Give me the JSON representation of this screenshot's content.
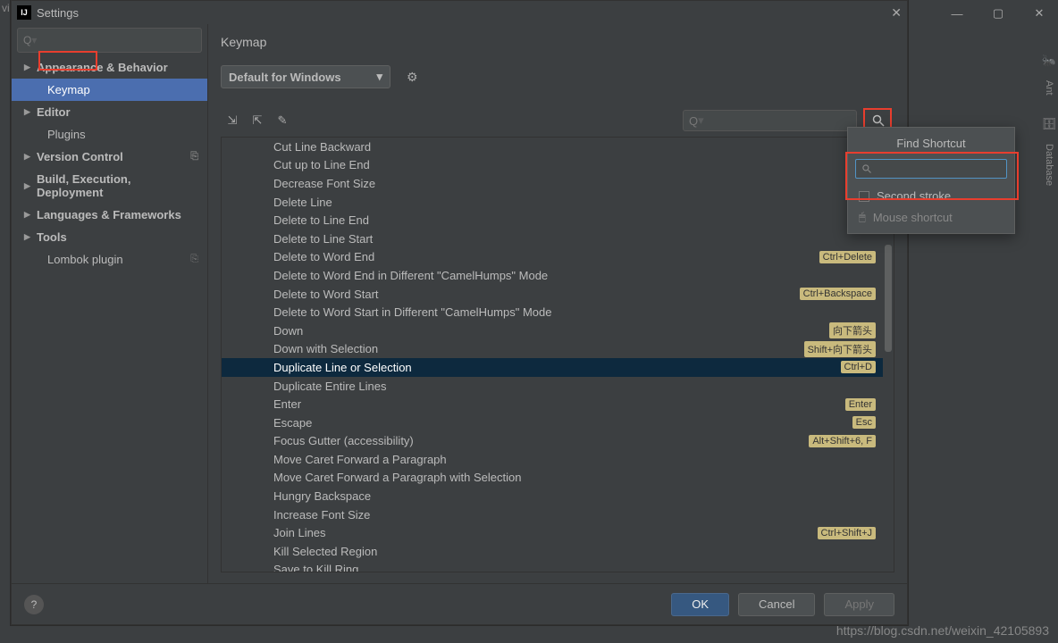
{
  "window": {
    "title": "Settings"
  },
  "tool_sidebar": {
    "ant_label": "Ant",
    "db_label": "Database"
  },
  "sidebar": {
    "items": [
      {
        "label": "Appearance & Behavior",
        "arrow": "▶",
        "bold": true
      },
      {
        "label": "Keymap",
        "selected": true
      },
      {
        "label": "Editor",
        "arrow": "▶",
        "bold": true
      },
      {
        "label": "Plugins"
      },
      {
        "label": "Version Control",
        "arrow": "▶",
        "bold": true,
        "badge": "⎘"
      },
      {
        "label": "Build, Execution, Deployment",
        "arrow": "▶",
        "bold": true
      },
      {
        "label": "Languages & Frameworks",
        "arrow": "▶",
        "bold": true
      },
      {
        "label": "Tools",
        "arrow": "▶",
        "bold": true
      },
      {
        "label": "Lombok plugin",
        "badge": "⎘"
      }
    ]
  },
  "main": {
    "heading": "Keymap",
    "scheme_label": "Default for Windows",
    "actions": [
      {
        "label": "Cut Line Backward"
      },
      {
        "label": "Cut up to Line End"
      },
      {
        "label": "Decrease Font Size"
      },
      {
        "label": "Delete Line"
      },
      {
        "label": "Delete to Line End"
      },
      {
        "label": "Delete to Line Start"
      },
      {
        "label": "Delete to Word End",
        "shortcut": "Ctrl+Delete"
      },
      {
        "label": "Delete to Word End in Different \"CamelHumps\" Mode"
      },
      {
        "label": "Delete to Word Start",
        "shortcut": "Ctrl+Backspace"
      },
      {
        "label": "Delete to Word Start in Different \"CamelHumps\" Mode"
      },
      {
        "label": "Down",
        "shortcut": "向下箭头"
      },
      {
        "label": "Down with Selection",
        "shortcut": "Shift+向下箭头"
      },
      {
        "label": "Duplicate Line or Selection",
        "shortcut": "Ctrl+D",
        "selected": true
      },
      {
        "label": "Duplicate Entire Lines"
      },
      {
        "label": "Enter",
        "shortcut": "Enter"
      },
      {
        "label": "Escape",
        "shortcut": "Esc"
      },
      {
        "label": "Focus Gutter (accessibility)",
        "shortcut": "Alt+Shift+6, F"
      },
      {
        "label": "Move Caret Forward a Paragraph"
      },
      {
        "label": "Move Caret Forward a Paragraph with Selection"
      },
      {
        "label": "Hungry Backspace"
      },
      {
        "label": "Increase Font Size"
      },
      {
        "label": "Join Lines",
        "shortcut": "Ctrl+Shift+J"
      },
      {
        "label": "Kill Selected Region"
      },
      {
        "label": "Save to Kill Ring"
      }
    ]
  },
  "popup": {
    "title": "Find Shortcut",
    "second_stroke": "Second stroke",
    "mouse_shortcut": "Mouse shortcut"
  },
  "footer": {
    "ok": "OK",
    "cancel": "Cancel",
    "apply": "Apply"
  },
  "watermark": "https://blog.csdn.net/weixin_42105893",
  "corner": "vig"
}
